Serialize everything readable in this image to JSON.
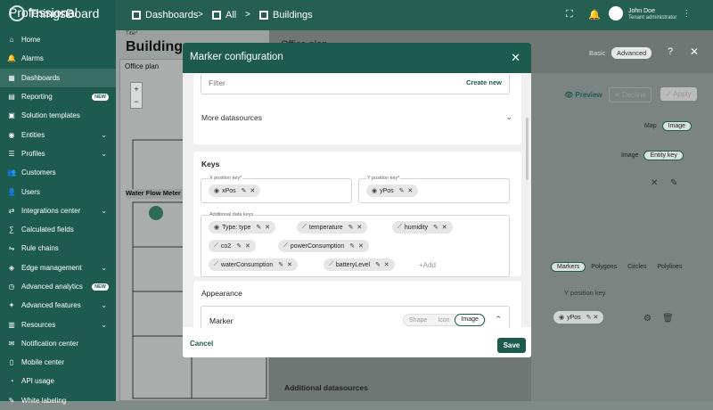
{
  "app": {
    "logo": "ThingsBoard",
    "logo_sub": "Professional"
  },
  "breadcrumb": {
    "items": [
      "Dashboards",
      "All",
      "Buildings"
    ],
    "sep": ">"
  },
  "user": {
    "name": "John Doe",
    "role": "Tenant administrator"
  },
  "sidebar": {
    "items": [
      {
        "label": "Home",
        "icon": "⌂"
      },
      {
        "label": "Alarms",
        "icon": "🔔"
      },
      {
        "label": "Dashboards",
        "icon": "▦",
        "active": true
      },
      {
        "label": "Reporting",
        "icon": "▤",
        "badge": "NEW"
      },
      {
        "label": "Solution templates",
        "icon": "▣"
      },
      {
        "label": "Entities",
        "icon": "◉",
        "chev": "⌄"
      },
      {
        "label": "Profiles",
        "icon": "☰",
        "chev": "⌄"
      },
      {
        "label": "Customers",
        "icon": "👥"
      },
      {
        "label": "Users",
        "icon": "👤"
      },
      {
        "label": "Integrations center",
        "icon": "⇄",
        "chev": "⌄"
      },
      {
        "label": "Calculated fields",
        "icon": "∑"
      },
      {
        "label": "Rule chains",
        "icon": "⇋"
      },
      {
        "label": "Edge management",
        "icon": "◈",
        "chev": "⌄"
      },
      {
        "label": "Advanced analytics",
        "icon": "◷",
        "badge": "NEW"
      },
      {
        "label": "Advanced features",
        "icon": "✦",
        "chev": "⌄"
      },
      {
        "label": "Resources",
        "icon": "▥",
        "chev": "⌄"
      },
      {
        "label": "Notification center",
        "icon": "✉"
      },
      {
        "label": "Mobile center",
        "icon": "▯"
      },
      {
        "label": "API usage",
        "icon": "◔"
      },
      {
        "label": "White labeling",
        "icon": "✎"
      }
    ]
  },
  "background": {
    "title_label": "Title*",
    "title_value": "Buildings",
    "office_plan": "Office plan",
    "water_meter": "Water Flow Meter",
    "right_title": "Office plan",
    "mode_basic": "Basic",
    "mode_advanced": "Advanced",
    "preview": "Preview",
    "decline": "Decline",
    "apply": "Apply",
    "map": "Map",
    "image": "Image",
    "image2": "Image",
    "entity_key": "Entity key",
    "markers": "Markers",
    "polygons": "Polygons",
    "circles": "Circles",
    "polylines": "Polylines",
    "y_position_key": "Y position key",
    "ypos": "yPos",
    "additional_datasources": "Additional datasources"
  },
  "modal": {
    "title": "Marker configuration",
    "filter_placeholder": "Filter",
    "create_new": "Create new",
    "more_datasources": "More datasources",
    "keys_title": "Keys",
    "x_label": "X position key*",
    "x_value": "xPos",
    "y_label": "Y position key*",
    "y_value": "yPos",
    "additional_label": "Additional data keys",
    "additional_keys": [
      "Type: type",
      "temperature",
      "humidity",
      "co2",
      "powerConsumption",
      "waterConsumption",
      "batteryLevel"
    ],
    "add_label": "+Add",
    "appearance_title": "Appearance",
    "marker_label": "Marker",
    "marker_types": [
      "Shape",
      "Icon",
      "Image"
    ],
    "cancel": "Cancel",
    "save": "Save"
  }
}
